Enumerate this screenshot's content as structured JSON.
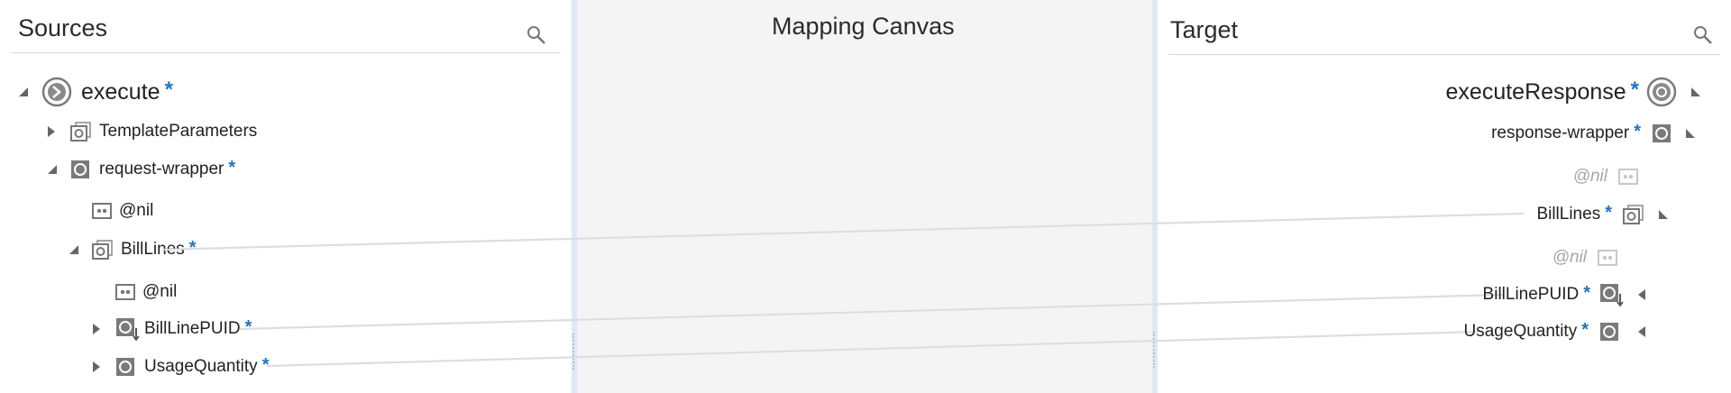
{
  "sources": {
    "title": "Sources",
    "search_icon": "search-icon",
    "tree": [
      {
        "label": "execute",
        "required": "*",
        "icon": "execute-icon",
        "expander": "expanded"
      },
      {
        "label": "TemplateParameters",
        "required": "",
        "icon": "repeating-element-icon",
        "expander": "collapsed"
      },
      {
        "label": "request-wrapper",
        "required": "*",
        "icon": "element-icon",
        "expander": "expanded"
      },
      {
        "label": "@nil",
        "required": "",
        "icon": "attribute-icon",
        "expander": "none"
      },
      {
        "label": "BillLines",
        "required": "*",
        "icon": "repeating-element-icon",
        "expander": "expanded"
      },
      {
        "label": "@nil",
        "required": "",
        "icon": "attribute-icon",
        "expander": "none"
      },
      {
        "label": "BillLinePUID",
        "required": "*",
        "icon": "element-mapped-icon",
        "expander": "collapsed"
      },
      {
        "label": "UsageQuantity",
        "required": "*",
        "icon": "element-icon",
        "expander": "collapsed"
      }
    ]
  },
  "canvas": {
    "title": "Mapping Canvas"
  },
  "target": {
    "title": "Target",
    "search_icon": "search-icon",
    "tree": [
      {
        "label": "executeResponse",
        "required": "*",
        "icon": "target-root-icon",
        "expander": "expanded"
      },
      {
        "label": "response-wrapper",
        "required": "*",
        "icon": "element-icon",
        "expander": "expanded"
      },
      {
        "label": "@nil",
        "required": "",
        "icon": "attribute-icon",
        "expander": "none"
      },
      {
        "label": "BillLines",
        "required": "*",
        "icon": "repeating-element-icon",
        "expander": "expanded"
      },
      {
        "label": "@nil",
        "required": "",
        "icon": "attribute-icon",
        "expander": "none"
      },
      {
        "label": "BillLinePUID",
        "required": "*",
        "icon": "element-mapped-icon",
        "expander": "collapsed"
      },
      {
        "label": "UsageQuantity",
        "required": "*",
        "icon": "element-icon",
        "expander": "collapsed"
      }
    ]
  },
  "mappings": [
    {
      "from": "BillLines",
      "to": "BillLines"
    },
    {
      "from": "BillLinePUID",
      "to": "BillLinePUID"
    },
    {
      "from": "UsageQuantity",
      "to": "UsageQuantity"
    }
  ],
  "colors": {
    "required_star": "#1f74c4",
    "splitter": "#dfe9f5",
    "canvas_bg": "#f4f4f5",
    "mapping_line": "#dcdde0"
  }
}
